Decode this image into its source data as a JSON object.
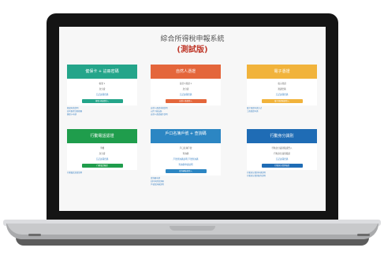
{
  "page": {
    "title": "綜合所得稅申報系統",
    "subtitle": "(測試版)"
  },
  "cards": [
    {
      "header": "健保卡 + 註冊密碼",
      "color": "#24a58a",
      "rows": [
        "帳號 1",
        "身分證",
        "忘記註冊密碼"
      ],
      "button": "健保卡驗證登入",
      "notes": [
        "帳號申請說明",
        "如何取得註冊密碼",
        "健保卡申請"
      ]
    },
    {
      "header": "自然人憑證",
      "color": "#e4663b",
      "rows": [
        "自然人憑證 1",
        "身分證",
        "忘記註冊密碼"
      ],
      "button": "自然人憑證登入",
      "notes": [
        "自然人憑證申辦說明",
        "元件下載安裝",
        "自然人憑證操作說明"
      ]
    },
    {
      "header": "電子憑證",
      "color": "#f1b33b",
      "rows": [
        "電子憑證",
        "憑證密碼",
        "忘記註冊密碼"
      ],
      "button": "電子憑證驗證登入",
      "notes": [
        "電子憑證申請方式",
        "工商憑證申請"
      ]
    },
    {
      "header": "行動電話認證",
      "color": "#1f9d4c",
      "rows": [
        "手機",
        "身分證",
        "忘記註冊密碼"
      ],
      "button": "行動電話驗證",
      "notes": [
        "行動電話認證說明"
      ]
    },
    {
      "header": "戶口名簿戶號 + 查詢碼",
      "color": "#2c86c3",
      "rows": [
        "戶口名簿戶號",
        "查詢碼",
        "戶號查詢碼說明 戶號查詢碼",
        "查詢碼申請說明"
      ],
      "button": "查詢碼驗證登入",
      "notes": [
        "查詢碼申請",
        "如何申請查詢碼",
        "戶號查詢碼說明"
      ]
    },
    {
      "header": "行動身分識別",
      "color": "#1f6cb5",
      "rows": [
        "行動身分識別驗證登入",
        "行動身分識別驗證",
        "忘記註冊密碼"
      ],
      "button": "行動身分識別驗證",
      "notes": [
        "行動身分識別申請說明",
        "行動身分識別操作說明"
      ]
    }
  ]
}
